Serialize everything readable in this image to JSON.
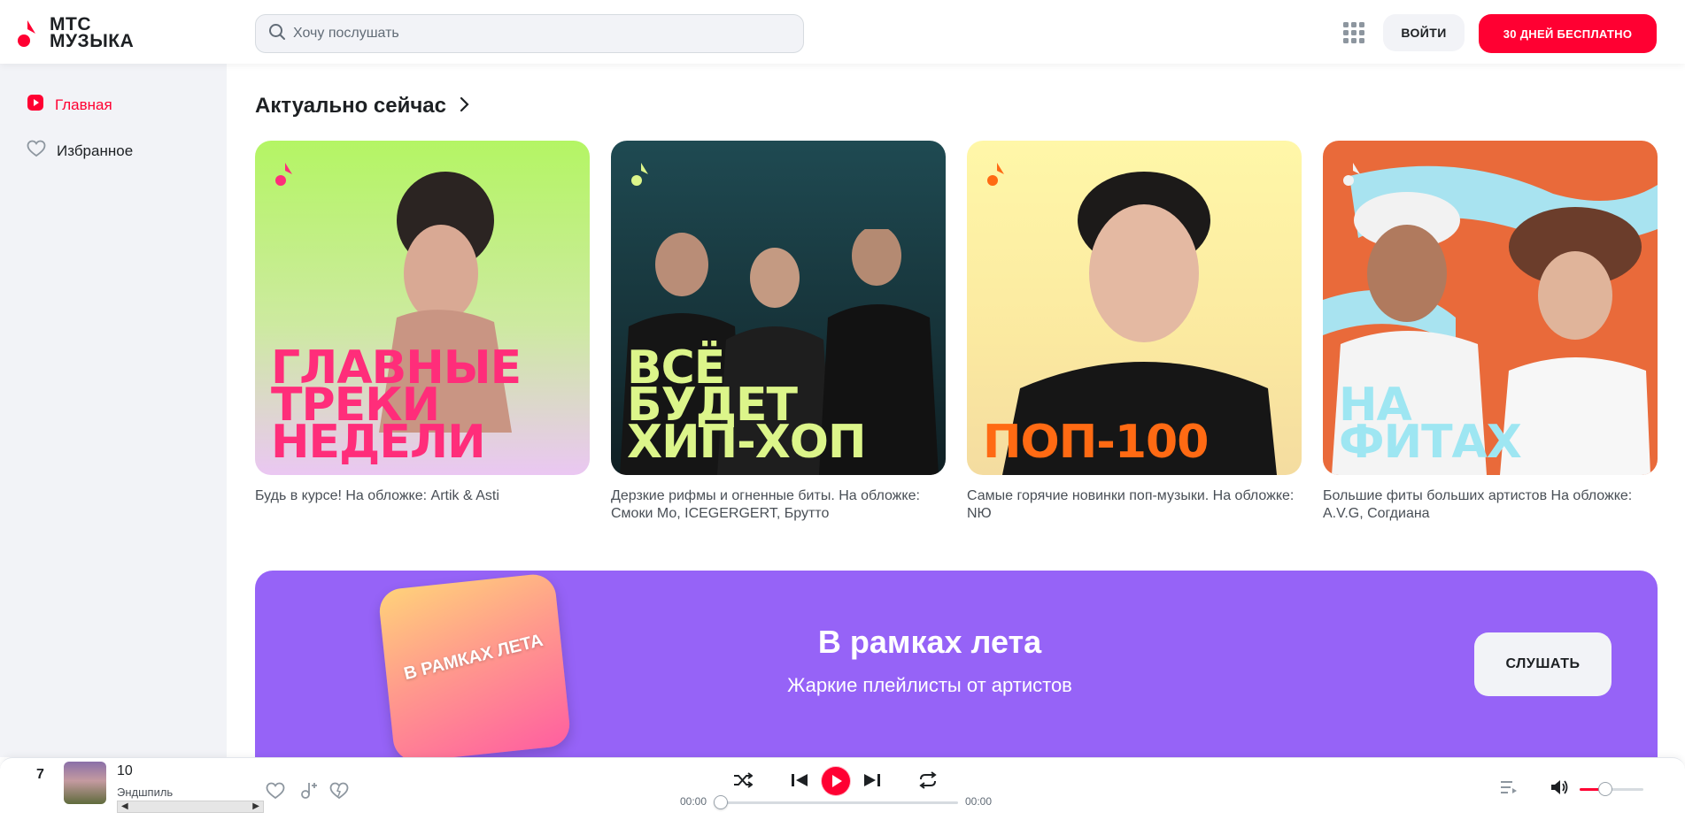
{
  "header": {
    "logo_line1": "МТС",
    "logo_line2": "МУЗЫКА",
    "search_placeholder": "Хочу послушать",
    "login_label": "ВОЙТИ",
    "trial_label": "30 ДНЕЙ БЕСПЛАТНО",
    "brand_color": "#ff0032"
  },
  "sidebar": {
    "items": [
      {
        "label": "Главная",
        "icon": "play-square-icon",
        "active": true
      },
      {
        "label": "Избранное",
        "icon": "heart-icon",
        "active": false
      }
    ]
  },
  "main": {
    "section_title": "Актуально сейчас",
    "cards": [
      {
        "cover_text": "ГЛАВНЫЕ ТРЕКИ НЕДЕЛИ",
        "description": "Будь в курсе! На обложке: Artik & Asti",
        "bg": "#b6f36a",
        "text_color": "#ff2d7a"
      },
      {
        "cover_text": "ВСЁ БУДЕТ ХИП-ХОП",
        "description": "Дерзкие рифмы и огненные биты. На обложке: Смоки Мо, ICEGERGERT, Брутто",
        "bg": "#1c3f47",
        "text_color": "#dcf58a"
      },
      {
        "cover_text": "ПОП-100",
        "description": "Самые горячие новинки поп-музыки. На обложке: NЮ",
        "bg": "#fdf4a6",
        "text_color": "#ff6a13"
      },
      {
        "cover_text": "НА ФИТАХ",
        "description": "Большие фиты больших артистов На обложке: A.V.G, Согдиана",
        "bg": "#e96a3a",
        "text_color": "#9ee6f2"
      }
    ],
    "promo": {
      "title": "В рамках лета",
      "subtitle": "Жаркие плейлисты от артистов",
      "art_text": "В РАМКАХ ЛЕТА",
      "button": "СЛУШАТЬ",
      "bg": "#9663f7"
    }
  },
  "player": {
    "track_number": "7",
    "title": "10",
    "artist": "Эндшпиль",
    "time_current": "00:00",
    "time_total": "00:00",
    "progress": 0,
    "volume": 0.4
  }
}
